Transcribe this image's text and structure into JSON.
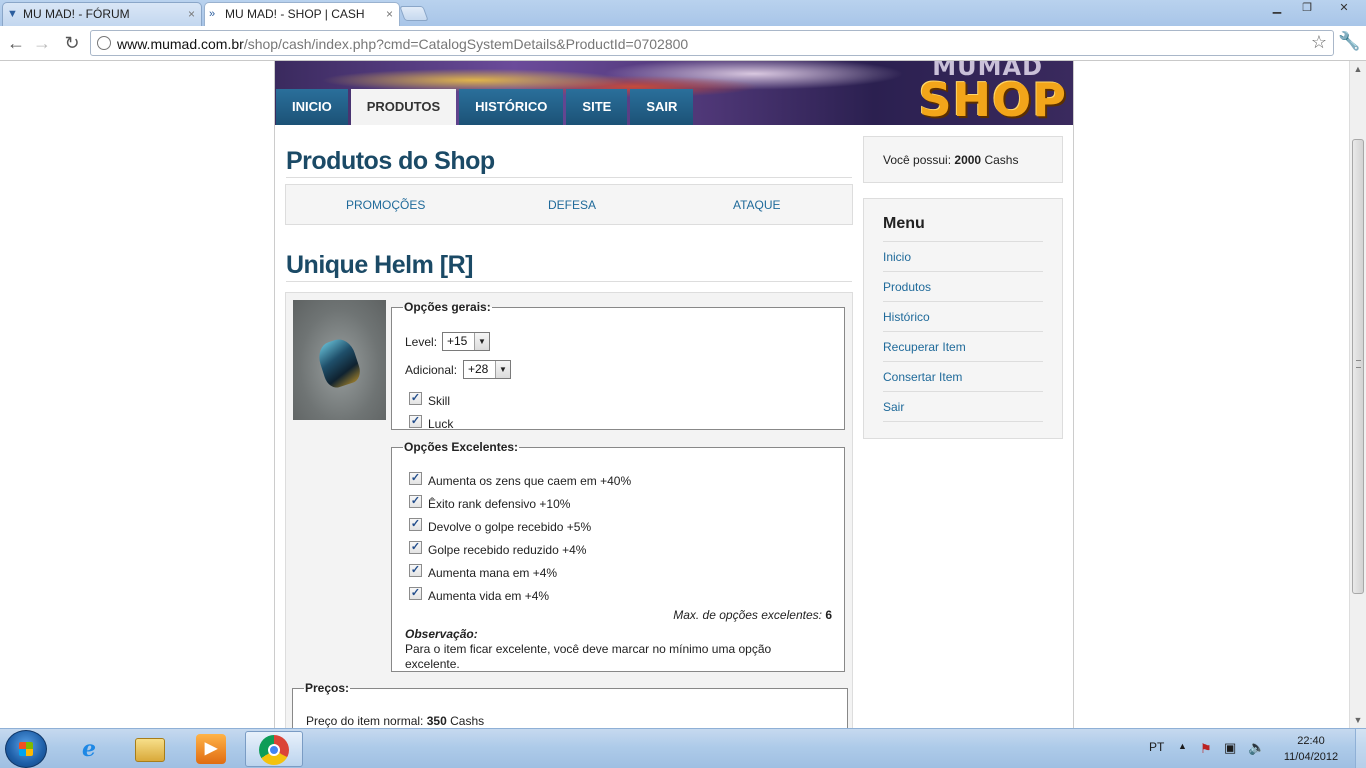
{
  "browser": {
    "tabs": [
      {
        "title": "MU MAD! - FÓRUM",
        "active": false
      },
      {
        "title": "MU MAD! - SHOP | CASH",
        "active": true
      }
    ],
    "url_domain": "www.mumad.com.br",
    "url_path": "/shop/cash/index.php?cmd=CatalogSystemDetails&ProductId=0702800"
  },
  "banner": {
    "brand_top": "MUMAD",
    "brand_main": "SHOP"
  },
  "nav": [
    {
      "label": "INICIO",
      "active": false
    },
    {
      "label": "PRODUTOS",
      "active": true
    },
    {
      "label": "HISTÓRICO",
      "active": false
    },
    {
      "label": "SITE",
      "active": false
    },
    {
      "label": "SAIR",
      "active": false
    }
  ],
  "main": {
    "title": "Produtos do Shop",
    "categories": [
      "PROMOÇÕES",
      "DEFESA",
      "ATAQUE"
    ],
    "product_name": "Unique Helm [R]",
    "general": {
      "legend": "Opções gerais:",
      "level_label": "Level:",
      "level_value": "+15",
      "additional_label": "Adicional:",
      "additional_value": "+28",
      "skill_label": "Skill",
      "skill_checked": true,
      "luck_label": "Luck",
      "luck_checked": true
    },
    "excellent": {
      "legend": "Opções Excelentes:",
      "options": [
        {
          "label": "Aumenta os zens que caem em +40%",
          "checked": true
        },
        {
          "label": "Êxito rank defensivo +10%",
          "checked": true
        },
        {
          "label": "Devolve o golpe recebido +5%",
          "checked": true
        },
        {
          "label": "Golpe recebido reduzido +4%",
          "checked": true
        },
        {
          "label": "Aumenta mana em +4%",
          "checked": true
        },
        {
          "label": "Aumenta vida em +4%",
          "checked": true
        }
      ],
      "max_label": "Max. de opções excelentes:",
      "max_value": "6",
      "note_title": "Observação:",
      "note_line1": "Para o item ficar excelente, você deve marcar no mínimo uma opção",
      "note_line2": "excelente."
    },
    "prices": {
      "legend": "Preços:",
      "normal_label": "Preço do item normal:",
      "normal_value": "350",
      "currency": "Cashs"
    }
  },
  "sidebar": {
    "balance_prefix": "Você possui:",
    "balance_value": "2000",
    "balance_unit": "Cashs",
    "menu_title": "Menu",
    "menu": [
      "Inicio",
      "Produtos",
      "Histórico",
      "Recuperar Item",
      "Consertar Item",
      "Sair"
    ]
  },
  "taskbar": {
    "language": "PT",
    "time": "22:40",
    "date": "11/04/2012",
    "pinned_icons": [
      "internet-explorer-icon",
      "windows-explorer-icon",
      "media-player-icon",
      "chrome-icon"
    ]
  }
}
